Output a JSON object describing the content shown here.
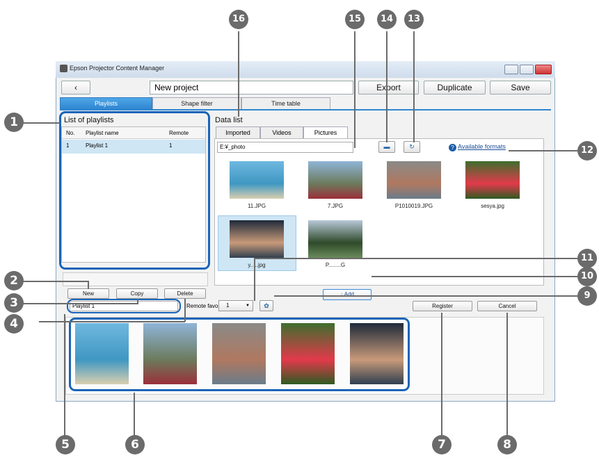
{
  "window": {
    "title": "Epson Projector Content Manager"
  },
  "toolbar": {
    "back_icon": "chevron-left-icon",
    "back_label": "‹",
    "project_name": "New project",
    "export_label": "Export",
    "duplicate_label": "Duplicate",
    "save_label": "Save"
  },
  "tabs": [
    {
      "label": "Playlists",
      "active": true
    },
    {
      "label": "Shape filter"
    },
    {
      "label": "Time table"
    }
  ],
  "playlists": {
    "heading": "List of playlists",
    "columns": [
      "No.",
      "Playlist name",
      "Remote"
    ],
    "rows": [
      {
        "no": "1",
        "name": "Playlist 1",
        "remote": "1"
      }
    ],
    "buttons": {
      "new": "New",
      "copy": "Copy",
      "delete": "Delete"
    }
  },
  "data_list": {
    "heading": "Data list",
    "tabs": [
      "Imported",
      "Videos",
      "Pictures"
    ],
    "path": "E:¥_photo",
    "available_formats": "Available formats",
    "items": [
      {
        "file": "11.JPG",
        "colors": [
          "#6fb8e0",
          "#3f97c2",
          "#d9cfb0"
        ]
      },
      {
        "file": "7.JPG",
        "colors": [
          "#8fb5d8",
          "#6c7a5c",
          "#9b2f3a"
        ]
      },
      {
        "file": "P1010019.JPG",
        "colors": [
          "#8a8a88",
          "#b07860",
          "#6a7c8a"
        ]
      },
      {
        "file": "sesya.jpg",
        "colors": [
          "#3e6e2e",
          "#e23a4a",
          "#2e5a22"
        ]
      },
      {
        "file": "y.....jpg",
        "colors": [
          "#1e2a3a",
          "#c89a7a",
          "#2f3f4f"
        ]
      },
      {
        "file": "P........G",
        "colors": [
          "#b8c8d8",
          "#2e4a2a",
          "#6a8a5a"
        ]
      }
    ],
    "add_label": "Add"
  },
  "editor": {
    "playlist_name": "Playlist 1",
    "remote_favorite_label": "Remote favorite",
    "remote_favorite_value": "1",
    "register_label": "Register",
    "cancel_label": "Cancel",
    "thumbs": [
      {
        "colors": [
          "#6fb8e0",
          "#3f97c2",
          "#d9cfb0"
        ]
      },
      {
        "colors": [
          "#8fb5d8",
          "#6c7a5c",
          "#9b2f3a"
        ]
      },
      {
        "colors": [
          "#8a8a88",
          "#b07860",
          "#6a7c8a"
        ]
      },
      {
        "colors": [
          "#3e6e2e",
          "#e23a4a",
          "#2e5a22"
        ]
      },
      {
        "colors": [
          "#1e2a3a",
          "#c89a7a",
          "#2f3f4f"
        ]
      }
    ]
  },
  "callouts": [
    "1",
    "2",
    "3",
    "4",
    "5",
    "6",
    "7",
    "8",
    "9",
    "10",
    "11",
    "12",
    "13",
    "14",
    "15",
    "16"
  ],
  "colors": {
    "accent": "#2f86d0",
    "highlight": "#1a64b8",
    "callout": "#6b6b6b"
  }
}
